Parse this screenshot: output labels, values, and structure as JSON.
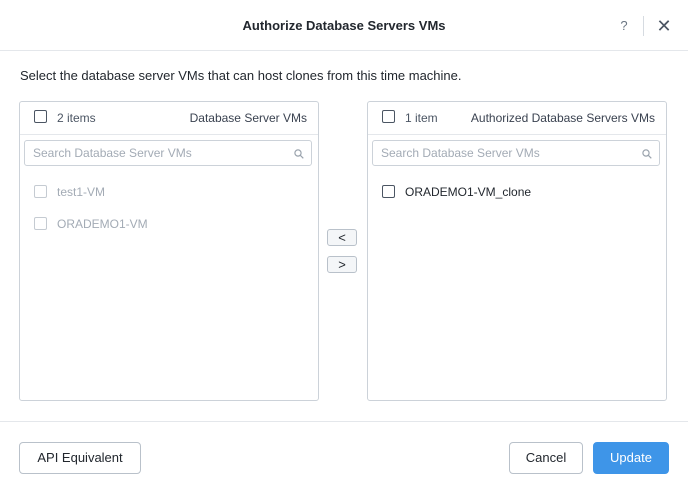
{
  "dialog": {
    "title": "Authorize Database Servers VMs",
    "help_label": "?",
    "close_label": "✕",
    "instruction": "Select the database server VMs that can host clones from this time machine."
  },
  "left_panel": {
    "count": "2 items",
    "label": "Database Server VMs",
    "search_placeholder": "Search Database Server VMs",
    "items": [
      {
        "label": "test1-VM",
        "enabled": false
      },
      {
        "label": "ORADEMO1-VM",
        "enabled": false
      }
    ]
  },
  "right_panel": {
    "count": "1 item",
    "label": "Authorized Database Servers VMs",
    "search_placeholder": "Search Database Server VMs",
    "items": [
      {
        "label": "ORADEMO1-VM_clone",
        "enabled": true
      }
    ]
  },
  "transfer": {
    "move_left_label": "<",
    "move_right_label": ">"
  },
  "footer": {
    "api_label": "API Equivalent",
    "cancel_label": "Cancel",
    "update_label": "Update"
  },
  "colors": {
    "primary": "#3e95e8",
    "border": "#ccd2d9",
    "text": "#22272e",
    "muted_text": "#a3abb5"
  },
  "icons": {
    "search": "search-icon",
    "close": "close-icon",
    "help": "help-icon"
  }
}
